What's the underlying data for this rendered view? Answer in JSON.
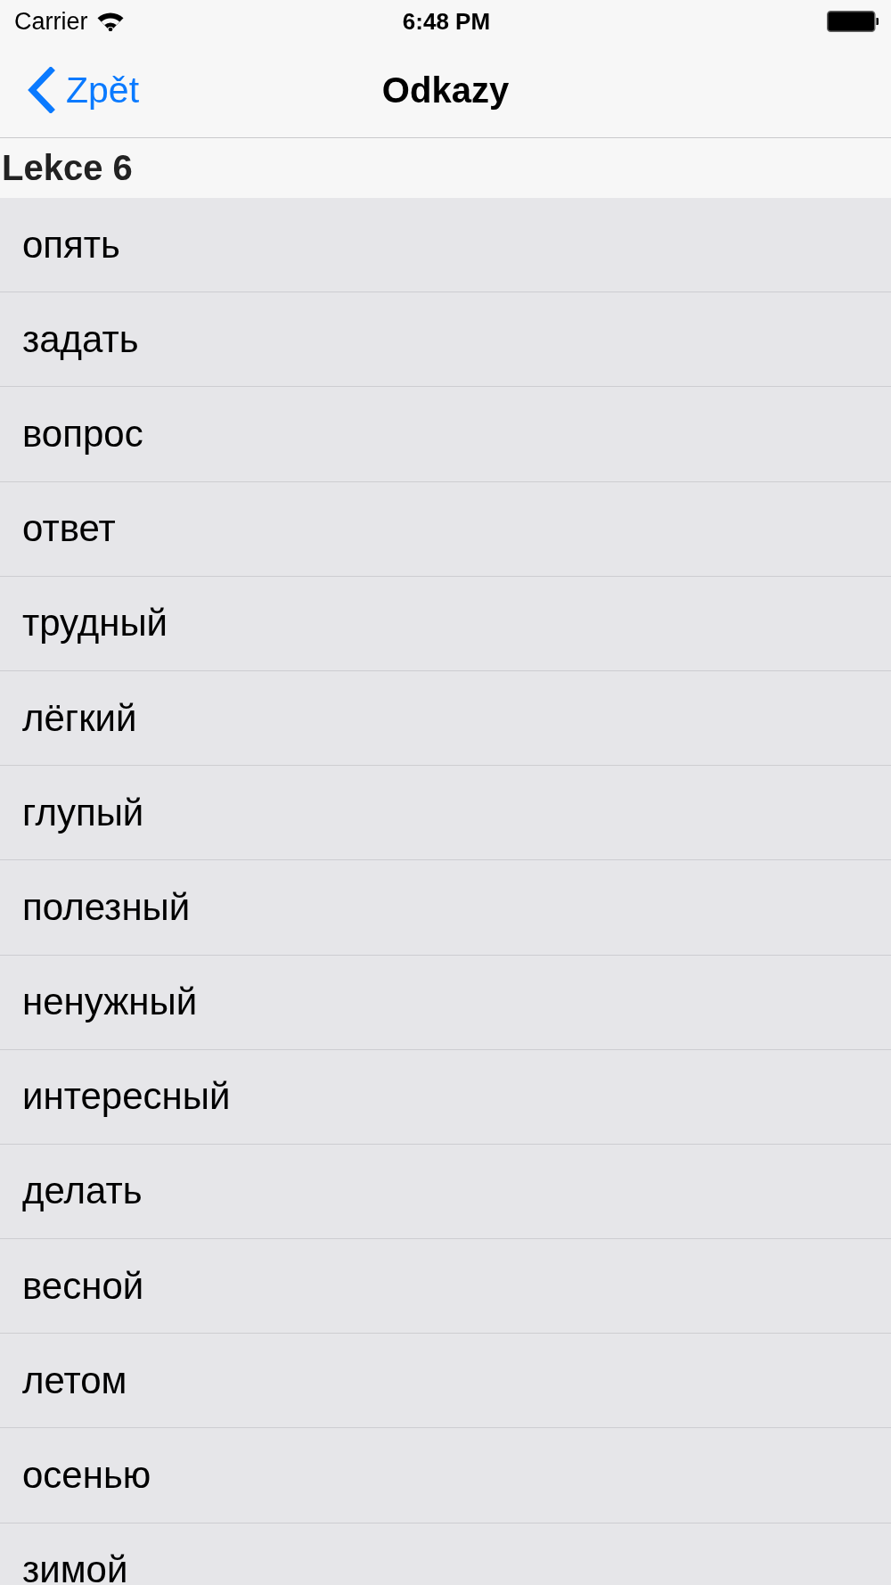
{
  "status_bar": {
    "carrier": "Carrier",
    "time": "6:48 PM"
  },
  "nav_bar": {
    "back_label": "Zpět",
    "title": "Odkazy"
  },
  "section": {
    "title": "Lekce 6",
    "rows": [
      "опять",
      "задать",
      "вопрос",
      "ответ",
      "трудный",
      "лёгкий",
      "глупый",
      "полезный",
      "ненужный",
      "интересный",
      "делать",
      "весной",
      "летом",
      "осенью",
      "зимой"
    ]
  }
}
